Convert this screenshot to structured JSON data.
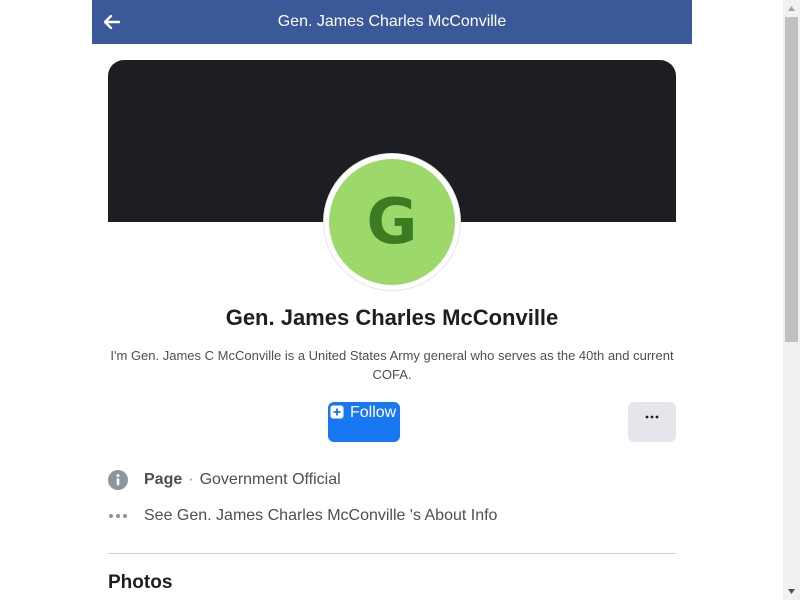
{
  "header": {
    "title": "Gen. James Charles McConville",
    "back_icon": "arrow-left-icon",
    "background_color": "#3b5998"
  },
  "profile": {
    "avatar_letter": "G",
    "avatar_color": "#9dd86a",
    "avatar_letter_color": "#3b7b22",
    "name": "Gen. James Charles McConville",
    "bio": "I'm Gen. James C McConville is a United States Army general who serves as the 40th and current COFA."
  },
  "actions": {
    "follow_label": "Follow",
    "follow_icon": "plus-square-icon",
    "follow_color": "#1877f2",
    "more_icon": "more-dots-icon"
  },
  "info": {
    "page_label": "Page",
    "separator": "·",
    "category": "Government Official",
    "about_text": "See Gen. James Charles McConville 's About Info"
  },
  "sections": {
    "photos_title": "Photos"
  }
}
